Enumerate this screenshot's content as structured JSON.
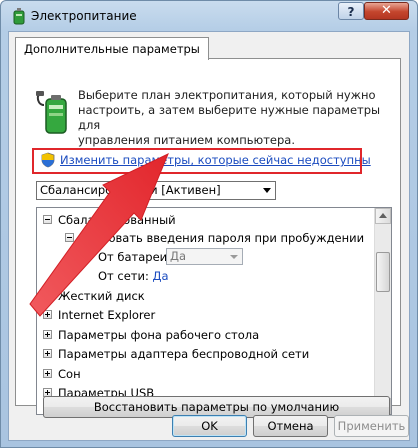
{
  "window": {
    "title": "Электропитание",
    "help_label": "?",
    "close_label": "✕"
  },
  "tab": {
    "label": "Дополнительные параметры"
  },
  "description": {
    "line1": "Выберите план электропитания, который нужно",
    "line2": "настроить, а затем выберите нужные параметры для",
    "line3": "управления питанием компьютера."
  },
  "change_link": {
    "label": "Изменить параметры, которые сейчас недоступны"
  },
  "plan_select": {
    "value": "Сбалансированный [Активен]"
  },
  "tree": {
    "root": {
      "label": "Сбалансированный"
    },
    "password": {
      "label": "Требовать введения пароля при пробуждении"
    },
    "battery": {
      "label": "От батареи:",
      "value": "Да"
    },
    "network": {
      "label": "От сети:",
      "value": "Да"
    },
    "items": [
      {
        "label": "Жесткий диск"
      },
      {
        "label": "Internet Explorer"
      },
      {
        "label": "Параметры фона рабочего стола"
      },
      {
        "label": "Параметры адаптера беспроводной сети"
      },
      {
        "label": "Сон"
      },
      {
        "label": "Параметры USB"
      }
    ]
  },
  "buttons": {
    "restore": "Восстановить параметры по умолчанию",
    "ok": "OK",
    "cancel": "Отмена",
    "apply": "Применить"
  },
  "colors": {
    "highlight_box": "#e0262b",
    "arrow": "#ee3a3e",
    "link": "#1a4bbf"
  },
  "icons": {
    "app": "battery-plug-icon",
    "power_plan": "battery-plug-icon",
    "uac": "uac-shield-icon"
  }
}
